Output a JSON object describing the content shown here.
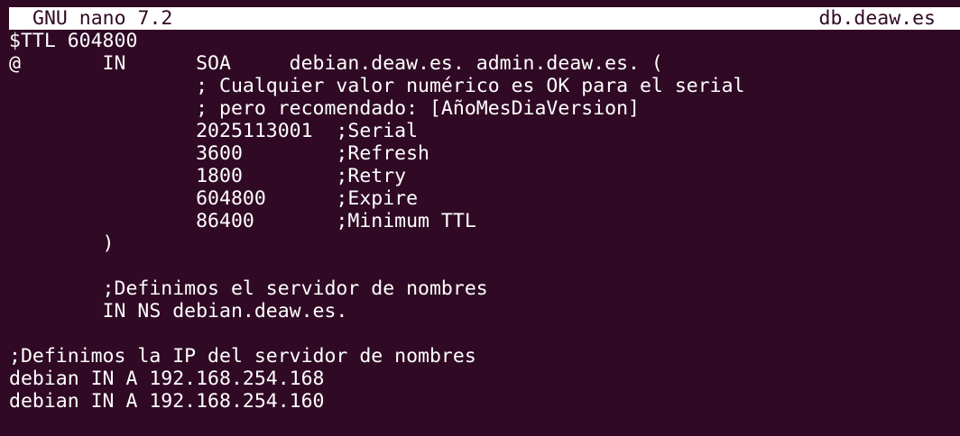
{
  "titlebar": {
    "app": "GNU nano 7.2",
    "filename": "db.deaw.es"
  },
  "editor": {
    "lines": [
      "$TTL 604800",
      "@       IN      SOA     debian.deaw.es. admin.deaw.es. (",
      "                ; Cualquier valor numérico es OK para el serial",
      "                ; pero recomendado: [AñoMesDiaVersion]",
      "                2025113001  ;Serial",
      "                3600        ;Refresh",
      "                1800        ;Retry",
      "                604800      ;Expire",
      "                86400       ;Minimum TTL",
      "        )",
      "",
      "        ;Definimos el servidor de nombres",
      "        IN NS debian.deaw.es.",
      "",
      ";Definimos la IP del servidor de nombres",
      "debian IN A 192.168.254.168",
      "debian IN A 192.168.254.160"
    ]
  }
}
